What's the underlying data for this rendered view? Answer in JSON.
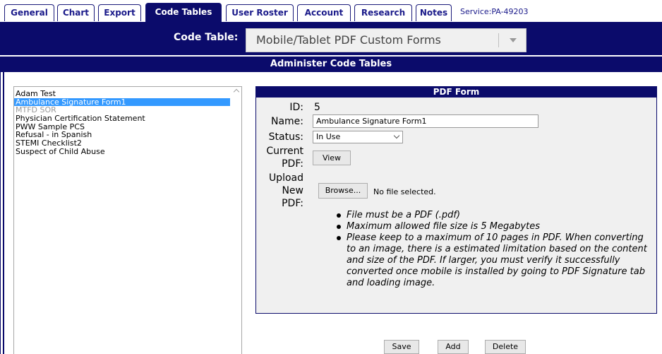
{
  "tabs": [
    {
      "label": "General"
    },
    {
      "label": "Chart"
    },
    {
      "label": "Export"
    },
    {
      "label": "Code Tables"
    },
    {
      "label": "User Roster"
    },
    {
      "label": "Account"
    },
    {
      "label": "Research"
    },
    {
      "label": "Notes"
    }
  ],
  "active_tab": "Code Tables",
  "service": "Service:PA-49203",
  "code_table": {
    "label": "Code Table:",
    "selected": "Mobile/Tablet PDF Custom Forms"
  },
  "admin_title": "Administer Code Tables",
  "list": [
    {
      "label": "Adam Test",
      "state": "normal"
    },
    {
      "label": "Ambulance Signature Form1",
      "state": "selected"
    },
    {
      "label": "MTFD SOR",
      "state": "disabled"
    },
    {
      "label": "Physician Certification Statement",
      "state": "normal"
    },
    {
      "label": "PWW Sample PCS",
      "state": "normal"
    },
    {
      "label": "Refusal - in Spanish",
      "state": "normal"
    },
    {
      "label": "STEMI Checklist2",
      "state": "normal"
    },
    {
      "label": "Suspect of Child Abuse",
      "state": "normal"
    }
  ],
  "form": {
    "title": "PDF Form",
    "id_label": "ID:",
    "id_value": "5",
    "name_label": "Name:",
    "name_value": "Ambulance Signature Form1",
    "status_label": "Status:",
    "status_value": "In Use",
    "current_pdf_label_1": "Current",
    "current_pdf_label_2": "PDF:",
    "view_button": "View",
    "upload_label_1": "Upload",
    "upload_label_2": "New",
    "upload_label_3": "PDF:",
    "browse_button": "Browse...",
    "file_status": "No file selected.",
    "notes": [
      "File must be a PDF (.pdf)",
      "Maximum allowed file size is 5 Megabytes",
      "Please keep to a maximum of 10 pages in PDF. When converting to an image, there is a estimated limitation based on the content and size of the PDF. If larger, you must verify it successfully converted once mobile is installed by going to PDF Signature tab and loading image."
    ]
  },
  "buttons": {
    "save": "Save",
    "add": "Add",
    "delete": "Delete"
  }
}
